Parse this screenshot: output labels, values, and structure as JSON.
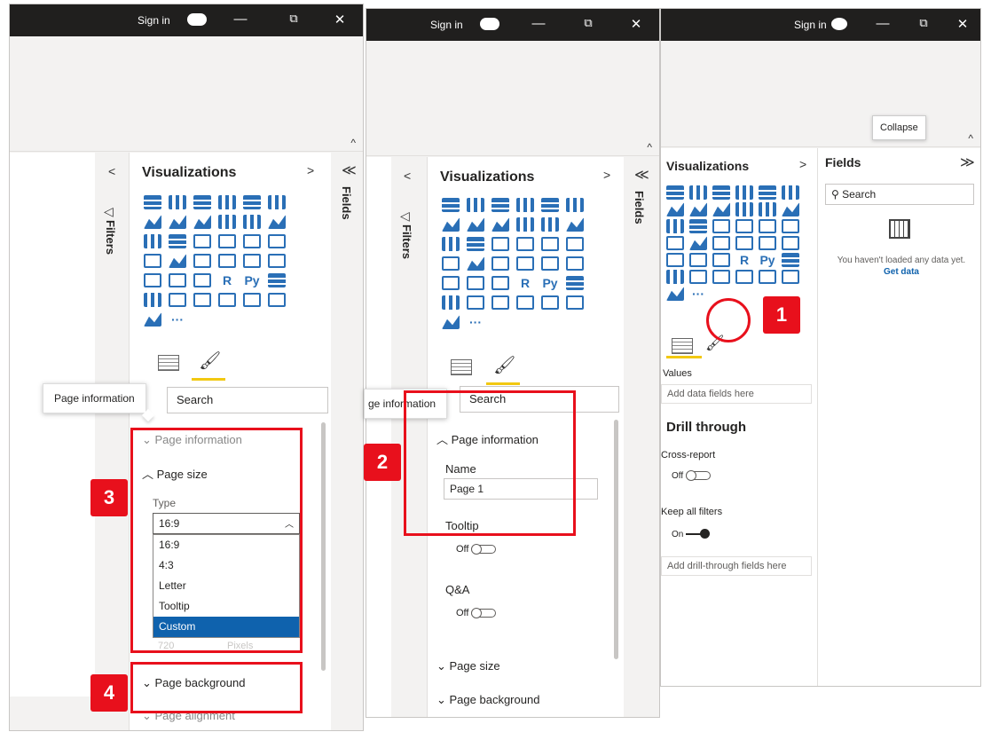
{
  "titlebar": {
    "sign_in": "Sign in",
    "minimize": "—",
    "restore": "⧉",
    "close": "✕"
  },
  "ribbon": {
    "collapse_caret": "^",
    "collapse_tooltip": "Collapse"
  },
  "panes": {
    "filters": "Filters",
    "fields": "Fields",
    "visualizations": "Visualizations",
    "expand_left": "<",
    "expand_right": ">",
    "collapse_all": "≪",
    "expand_all": "≫"
  },
  "search": {
    "label": "Search"
  },
  "tooltip": {
    "page_information": "Page information",
    "page_information_clipped": "ge information"
  },
  "format": {
    "page_information": "Page information",
    "page_size": "Page size",
    "page_background": "Page background",
    "page_alignment": "Page alignment",
    "type_label": "Type",
    "type_value": "16:9",
    "type_options": [
      "16:9",
      "4:3",
      "Letter",
      "Tooltip",
      "Custom"
    ],
    "selected_option": "Custom",
    "name_label": "Name",
    "name_value": "Page 1",
    "tooltip_label": "Tooltip",
    "tooltip_state": "Off",
    "qa_label": "Q&A",
    "qa_state": "Off",
    "faded_width": "720",
    "faded_unit": "Pixels"
  },
  "viz_icons": {
    "r": "R",
    "py": "Py",
    "more": "···"
  },
  "fields_pane": {
    "search": "Search",
    "empty_msg": "You haven't loaded any data yet.",
    "get_data": "Get data",
    "values": "Values",
    "add_data": "Add data fields here",
    "drill_through": "Drill through",
    "cross_report": "Cross-report",
    "cross_report_state": "Off",
    "keep_filters": "Keep all filters",
    "keep_filters_state": "On",
    "add_drill": "Add drill-through fields here"
  },
  "badges": [
    "1",
    "2",
    "3",
    "4"
  ],
  "colors": {
    "highlight": "#e8101c",
    "accent": "#f2c811",
    "selected": "#0f62ad",
    "titlebar": "#201f1e"
  }
}
